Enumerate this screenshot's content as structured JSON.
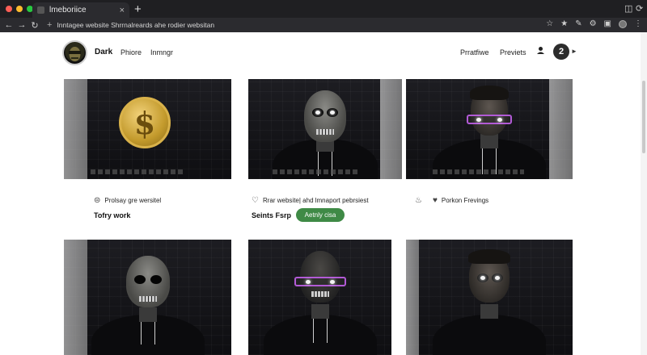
{
  "browser": {
    "tab_title": "lmeboriice",
    "url": "Inntagee website Shrrnalreards ahe rodier websitan",
    "colors": {
      "dot_red": "#ff5f57",
      "dot_yellow": "#febc2e",
      "dot_green": "#28c840"
    }
  },
  "header": {
    "brand": "Dark",
    "nav": [
      "Phiore",
      "Inmngr"
    ],
    "right_links": [
      "Prratfiwe",
      "Previets"
    ],
    "badge": "2"
  },
  "cards": [
    {
      "subject": "coin",
      "meta": "Prolsay gre wersitel",
      "meta_icon": "coin-icon",
      "title": "Tofry work"
    },
    {
      "subject": "skull",
      "meta": "Rrar website| ahd lmnaport pebrsiest",
      "meta_icon": "heart-outline-icon",
      "title": "Seints Fsrp",
      "button": "Aetnly cisa"
    },
    {
      "subject": "human-glasses",
      "meta": "Porkon Frevings",
      "meta_icon": "heart-icon",
      "pre_icon": "flame-icon"
    },
    {
      "subject": "skull"
    },
    {
      "subject": "human-glasses-purple"
    },
    {
      "subject": "human-glow"
    }
  ],
  "accent": "#3f8a46"
}
